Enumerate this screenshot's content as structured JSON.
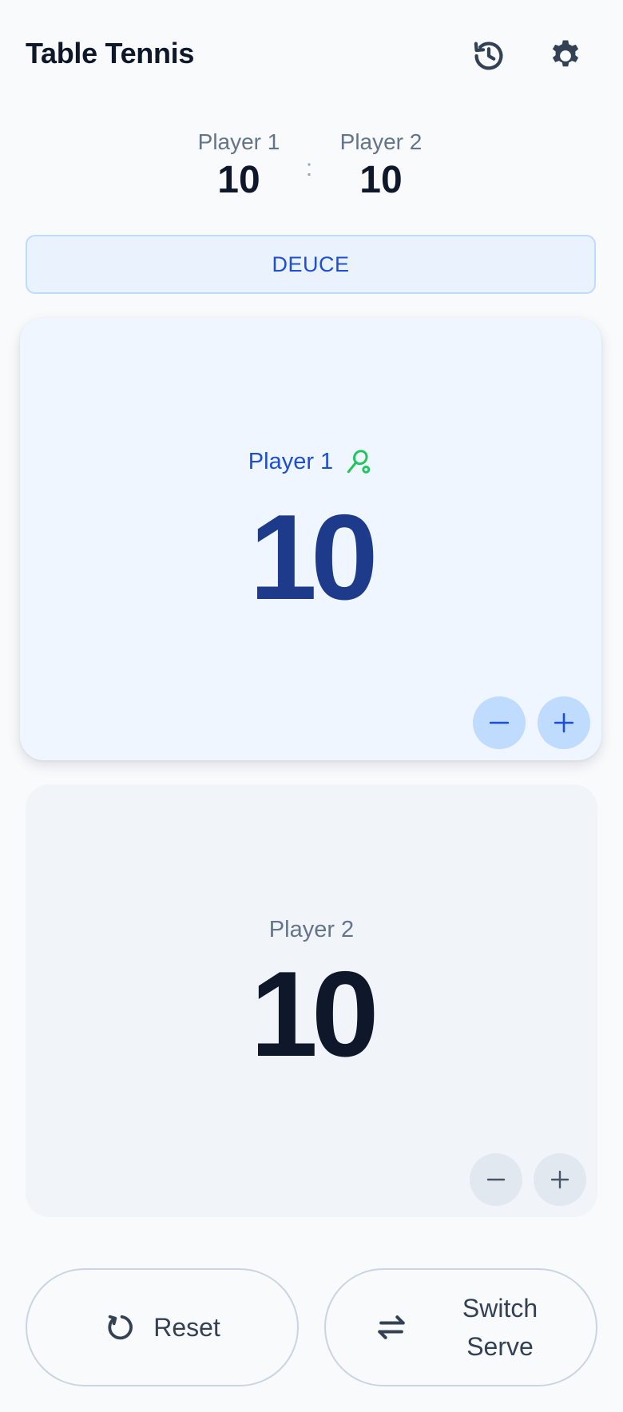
{
  "header": {
    "title": "Table Tennis",
    "history_icon": "history-icon",
    "settings_icon": "gear-icon"
  },
  "summary": {
    "player1": {
      "name": "Player 1",
      "score": "10"
    },
    "separator": ":",
    "player2": {
      "name": "Player 2",
      "score": "10"
    }
  },
  "status": {
    "label": "DEUCE"
  },
  "players": [
    {
      "name": "Player 1",
      "score": "10",
      "serving": true,
      "serve_icon": "racket-icon",
      "decrement_icon": "minus-icon",
      "increment_icon": "plus-icon"
    },
    {
      "name": "Player 2",
      "score": "10",
      "serving": false,
      "decrement_icon": "minus-icon",
      "increment_icon": "plus-icon"
    }
  ],
  "actions": {
    "reset": {
      "label": "Reset",
      "icon": "reset-icon"
    },
    "switch_serve": {
      "label": "Switch Serve",
      "icon": "swap-arrows-icon"
    }
  },
  "colors": {
    "accent": "#1d4ed8",
    "serve_indicator": "#22c55e",
    "active_card_bg": "#eff6ff",
    "inactive_card_bg": "#f1f5f9"
  }
}
